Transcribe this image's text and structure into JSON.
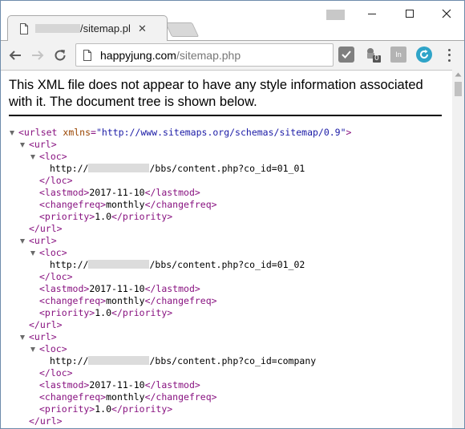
{
  "tab": {
    "title": "/sitemap.php"
  },
  "address_bar": {
    "host": "happyjung.com",
    "path": "/sitemap.php"
  },
  "extensions": {
    "badge_count": "0",
    "ext3_label": "In"
  },
  "page": {
    "notice": "This XML file does not appear to have any style information associated with it. The document tree is shown below.",
    "xml": {
      "urlset_open": "<urlset",
      "urlset_attr_name": "xmlns",
      "urlset_attr_value": "\"http://www.sitemaps.org/schemas/sitemap/0.9\"",
      "entries": [
        {
          "loc_prefix": "http://",
          "loc_path": "/bbs/content.php?co_id=01_01",
          "lastmod": "2017-11-10",
          "changefreq": "monthly",
          "priority": "1.0"
        },
        {
          "loc_prefix": "http://",
          "loc_path": "/bbs/content.php?co_id=01_02",
          "lastmod": "2017-11-10",
          "changefreq": "monthly",
          "priority": "1.0"
        },
        {
          "loc_prefix": "http://",
          "loc_path": "/bbs/content.php?co_id=company",
          "lastmod": "2017-11-10",
          "changefreq": "monthly",
          "priority": "1.0"
        }
      ]
    }
  }
}
